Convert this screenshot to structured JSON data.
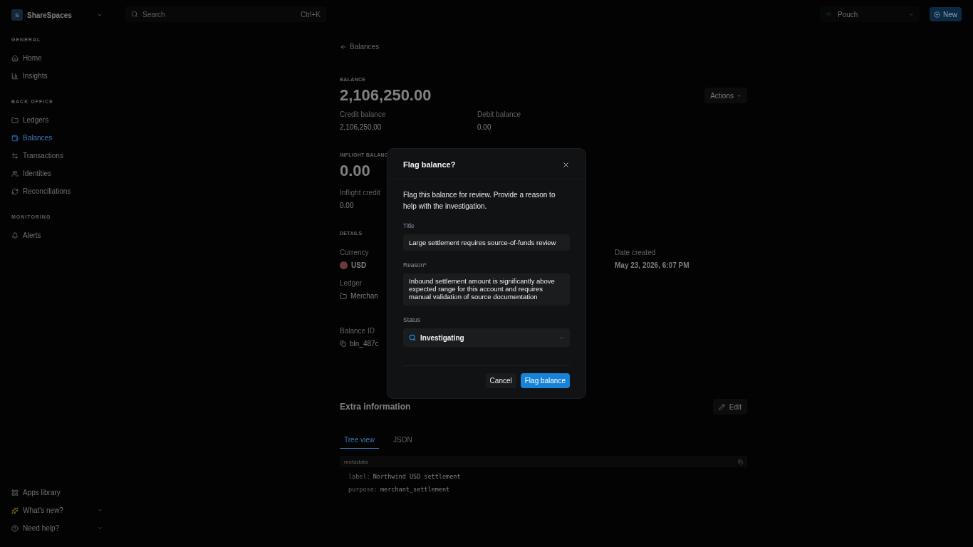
{
  "sidebar": {
    "workspace": {
      "initial": "S",
      "name": "ShareSpaces"
    },
    "sections": [
      {
        "title": "GENERAL",
        "items": [
          {
            "label": "Home",
            "selected": false
          },
          {
            "label": "Insights",
            "selected": false
          }
        ]
      },
      {
        "title": "BACK OFFICE",
        "items": [
          {
            "label": "Ledgers",
            "selected": false
          },
          {
            "label": "Balances",
            "selected": true
          },
          {
            "label": "Transactions",
            "selected": false
          },
          {
            "label": "Identities",
            "selected": false
          },
          {
            "label": "Reconciliations",
            "selected": false
          }
        ]
      },
      {
        "title": "MONITORING",
        "items": [
          {
            "label": "Alerts",
            "selected": false
          }
        ]
      }
    ],
    "footer": [
      {
        "label": "Apps library",
        "expandable": false
      },
      {
        "label": "What's new?",
        "expandable": true
      },
      {
        "label": "Need help?",
        "expandable": true
      }
    ]
  },
  "topbar": {
    "search": {
      "placeholder": "Search",
      "shortcut": "Ctrl+K"
    },
    "environment": "Pouch",
    "new_button": "New"
  },
  "page": {
    "back_link": "Balances",
    "balance": {
      "label": "BALANCE",
      "amount": "2,106,250.00",
      "actions": "Actions",
      "stats": [
        {
          "label": "Credit balance",
          "value": "2,106,250.00"
        },
        {
          "label": "Debit balance",
          "value": "0.00"
        }
      ]
    },
    "inflight": {
      "label": "INFLIGHT BALANC",
      "amount": "0.00",
      "stats": [
        {
          "label": "Inflight credit",
          "value": "0.00"
        }
      ]
    },
    "details": {
      "label": "DETAILS",
      "fields": [
        {
          "label": "Currency",
          "value": "USD"
        },
        {
          "label": "Date created",
          "value": "May 23, 2026, 6:07 PM"
        },
        {
          "label": "Ledger",
          "value": "Merchan"
        },
        {
          "label": "Balance ID",
          "value": "bln_487c"
        }
      ]
    },
    "extra": {
      "title": "Extra information",
      "edit": "Edit",
      "tabs": [
        {
          "label": "Tree view",
          "selected": true
        },
        {
          "label": "JSON",
          "selected": false
        }
      ],
      "metadata_label": "metadata",
      "entries": [
        {
          "key": "label:",
          "value": "Northwind USD settlement"
        },
        {
          "key": "purpose:",
          "value": "merchant_settlement"
        }
      ]
    }
  },
  "dialog": {
    "title": "Flag balance?",
    "description": "Flag this balance for review. Provide a reason to help with the investigation.",
    "title_field": {
      "label": "Title",
      "value": "Large settlement requires source-of-funds review"
    },
    "reason_field": {
      "label": "Reason*",
      "value": "Inbound settlement amount is significantly above expected range for this account and requires manual validation of source documentation"
    },
    "status_field": {
      "label": "Status",
      "value": "Investigating"
    },
    "buttons": {
      "cancel": "Cancel",
      "confirm": "Flag balance"
    }
  }
}
